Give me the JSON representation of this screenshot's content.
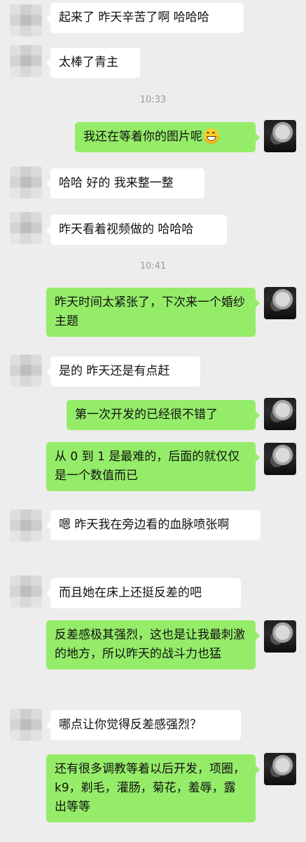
{
  "messages": [
    {
      "side": "left",
      "text": "起来了 昨天辛苦了啊 哈哈哈"
    },
    {
      "side": "left",
      "text": "太棒了青主"
    },
    {
      "type": "time",
      "text": "10:33"
    },
    {
      "side": "right",
      "text": "我还在等着你的图片呢",
      "emoji": "grinning-face-icon"
    },
    {
      "side": "left",
      "text": "哈哈 好的 我来整一整"
    },
    {
      "side": "left",
      "text": "昨天看着视频做的 哈哈哈"
    },
    {
      "type": "time",
      "text": "10:41"
    },
    {
      "side": "right",
      "text": "昨天时间太紧张了，下次来一个婚纱主题"
    },
    {
      "side": "left",
      "text": "是的 昨天还是有点赶"
    },
    {
      "side": "right",
      "text": "第一次开发的已经很不错了"
    },
    {
      "side": "right",
      "text": "从 0 到 1 是最难的，后面的就仅仅是一个数值而已"
    },
    {
      "side": "left",
      "text": "嗯 昨天我在旁边看的血脉喷张啊"
    },
    {
      "side": "left",
      "text": "而且她在床上还挺反差的吧"
    },
    {
      "side": "right",
      "text": "反差感极其强烈，这也是让我最刺激的地方，所以昨天的战斗力也猛"
    },
    {
      "side": "left",
      "text": "哪点让你觉得反差感强烈？"
    },
    {
      "side": "right",
      "text": "还有很多调教等着以后开发，项圈，k9，剃毛，灌肠，菊花，羞辱，露出等等"
    }
  ]
}
